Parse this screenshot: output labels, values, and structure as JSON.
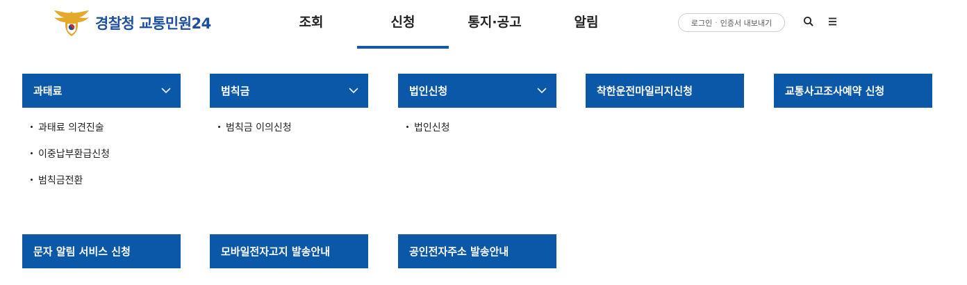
{
  "header": {
    "logo_text": "경찰청 교통민원24",
    "nav": [
      "조회",
      "신청",
      "통지·공고",
      "알림"
    ],
    "active_nav": "신청",
    "login_label": "로그인",
    "cert_label": "인증서 내보내기",
    "search_icon": "search-icon",
    "menu_icon": "hamburger-menu-icon"
  },
  "cards": [
    {
      "title": "과태료",
      "expandable": true,
      "items": [
        "과태료 의견진술",
        "이중납부환급신청",
        "범칙금전환"
      ]
    },
    {
      "title": "범칙금",
      "expandable": true,
      "items": [
        "범칙금 이의신청"
      ]
    },
    {
      "title": "법인신청",
      "expandable": true,
      "items": [
        "법인신청"
      ]
    },
    {
      "title": "착한운전마일리지신청",
      "expandable": false,
      "items": []
    },
    {
      "title": "교통사고조사예약 신청",
      "expandable": false,
      "items": []
    },
    {
      "title": "문자 알림 서비스 신청",
      "expandable": false,
      "items": []
    },
    {
      "title": "모바일전자고지 발송안내",
      "expandable": false,
      "items": []
    },
    {
      "title": "공인전자주소 발송안내",
      "expandable": false,
      "items": []
    }
  ],
  "colors": {
    "brand_blue": "#0b57a8",
    "logo_blue": "#1c4f9f",
    "emblem_gold": "#e3a92a"
  }
}
